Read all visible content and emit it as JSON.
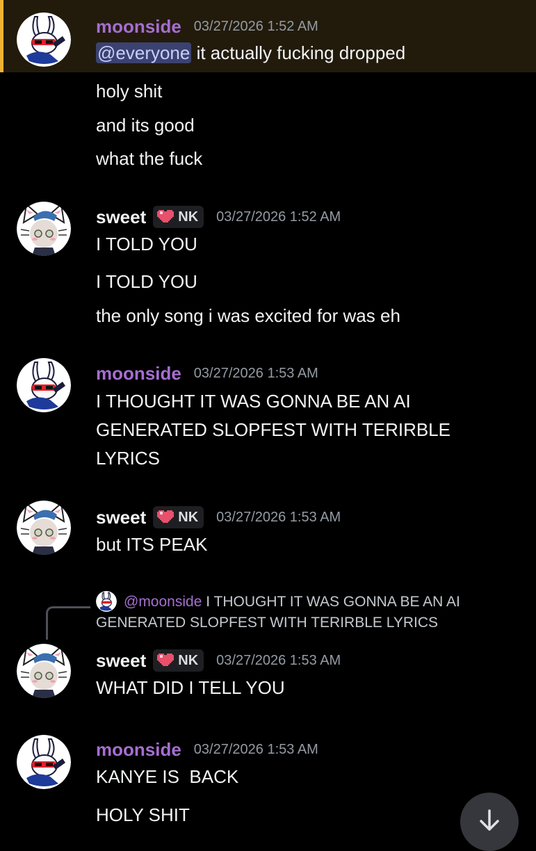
{
  "messages": [
    {
      "author": "moonside",
      "timestamp": "03/27/2026 1:52 AM",
      "avatar": "bunny-avatar",
      "highlighted": true,
      "lines": [
        {
          "mention": "@everyone",
          "text": " it actually fucking dropped"
        },
        {
          "text": "holy shit"
        },
        {
          "text": "and its good"
        },
        {
          "text": "what the fuck"
        }
      ]
    },
    {
      "author": "sweet",
      "tag": "NK",
      "timestamp": "03/27/2026 1:52 AM",
      "avatar": "cat-avatar",
      "lines": [
        {
          "text": "I TOLD YOU"
        },
        {
          "text": "I TOLD YOU"
        },
        {
          "text": "the only song i was excited for was eh"
        }
      ]
    },
    {
      "author": "moonside",
      "timestamp": "03/27/2026 1:53 AM",
      "avatar": "bunny-avatar",
      "lines": [
        {
          "text": "I THOUGHT IT WAS GONNA BE AN AI GENERATED SLOPFEST WITH TERIRBLE LYRICS"
        }
      ]
    },
    {
      "author": "sweet",
      "tag": "NK",
      "timestamp": "03/27/2026 1:53 AM",
      "avatar": "cat-avatar",
      "lines": [
        {
          "text": "but ITS PEAK"
        }
      ]
    },
    {
      "author": "sweet",
      "tag": "NK",
      "timestamp": "03/27/2026 1:53 AM",
      "avatar": "cat-avatar",
      "reply": {
        "author": "@moonside",
        "text_line1": "I THOUGHT IT WAS GONNA BE AN AI",
        "text_line2": "GENERATED SLOPFEST WITH TERIRBLE LYRICS"
      },
      "lines": [
        {
          "text": "WHAT DID I TELL YOU"
        }
      ]
    },
    {
      "author": "moonside",
      "timestamp": "03/27/2026 1:53 AM",
      "avatar": "bunny-avatar",
      "lines": [
        {
          "text": "KANYE IS  BACK"
        },
        {
          "text": "HOLY SHIT"
        }
      ]
    }
  ],
  "jump_button": {
    "icon": "arrow-down-icon"
  },
  "colors": {
    "background": "#000000",
    "mention_highlight": "#221b0c",
    "mention_bar": "#f0b232",
    "moonside_name": "#a56ed0",
    "timestamp": "#949ba4",
    "text": "#f2f3f5"
  }
}
